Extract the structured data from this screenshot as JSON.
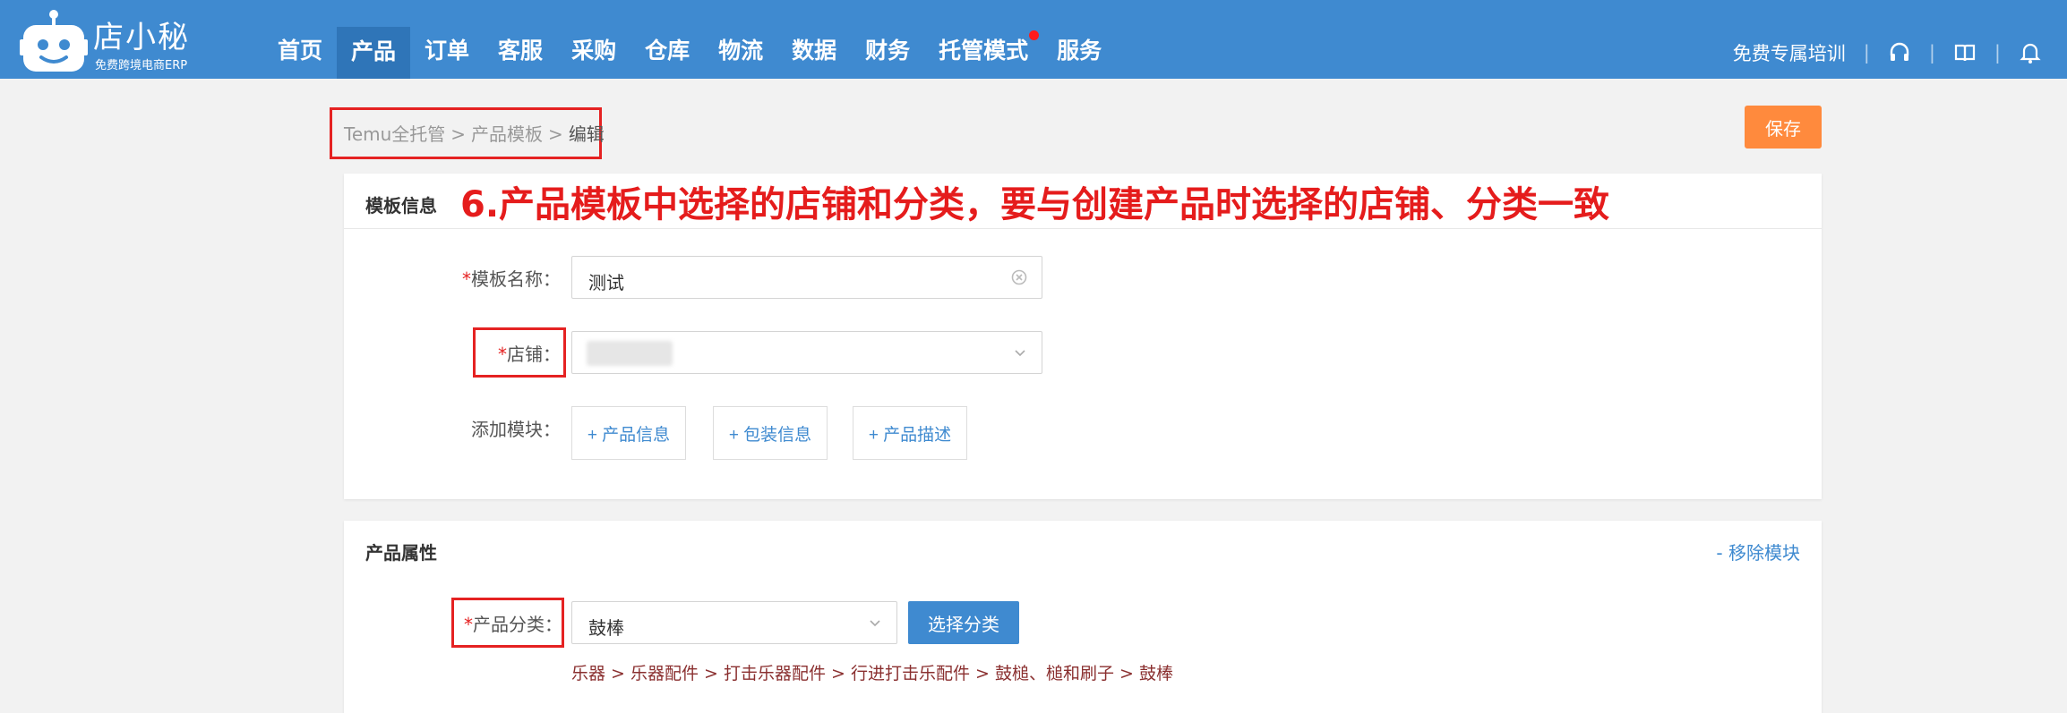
{
  "brand": {
    "name": "店小秘",
    "subtitle": "免费跨境电商ERP"
  },
  "nav": {
    "items": [
      {
        "label": "首页",
        "active": false
      },
      {
        "label": "产品",
        "active": true
      },
      {
        "label": "订单",
        "active": false
      },
      {
        "label": "客服",
        "active": false
      },
      {
        "label": "采购",
        "active": false
      },
      {
        "label": "仓库",
        "active": false
      },
      {
        "label": "物流",
        "active": false
      },
      {
        "label": "数据",
        "active": false
      },
      {
        "label": "财务",
        "active": false
      },
      {
        "label": "托管模式",
        "active": false,
        "badge": true
      },
      {
        "label": "服务",
        "active": false
      }
    ],
    "training": "免费专属培训",
    "sep": "|"
  },
  "breadcrumb": {
    "root": "Temu全托管",
    "parent": "产品模板",
    "current": "编辑",
    "gt": ">"
  },
  "toolbar": {
    "save_label": "保存"
  },
  "template_panel": {
    "title": "模板信息",
    "annotation": "6.产品模板中选择的店铺和分类，要与创建产品时选择的店铺、分类一致",
    "name_label": "模板名称",
    "name_value": "测试",
    "shop_label": "店铺",
    "add_module_label": "添加模块",
    "add_buttons": [
      "+ 产品信息",
      "+ 包装信息",
      "+ 产品描述"
    ],
    "colon": "："
  },
  "attr_panel": {
    "title": "产品属性",
    "remove_label": "- 移除模块",
    "category_label": "产品分类",
    "category_value": "鼓棒",
    "select_category_btn": "选择分类",
    "category_path": "乐器 > 乐器配件 > 打击乐器配件 > 行进打击乐配件 > 鼓槌、槌和刷子 > 鼓棒",
    "colon": "："
  },
  "colors": {
    "nav_bg": "#3f8ad0",
    "accent_orange": "#ff8a3d",
    "annotation_red": "#e51c1c"
  },
  "icons": [
    "robot-logo-icon",
    "headset-icon",
    "book-icon",
    "bell-icon",
    "clear-icon",
    "chevron-down-icon"
  ]
}
